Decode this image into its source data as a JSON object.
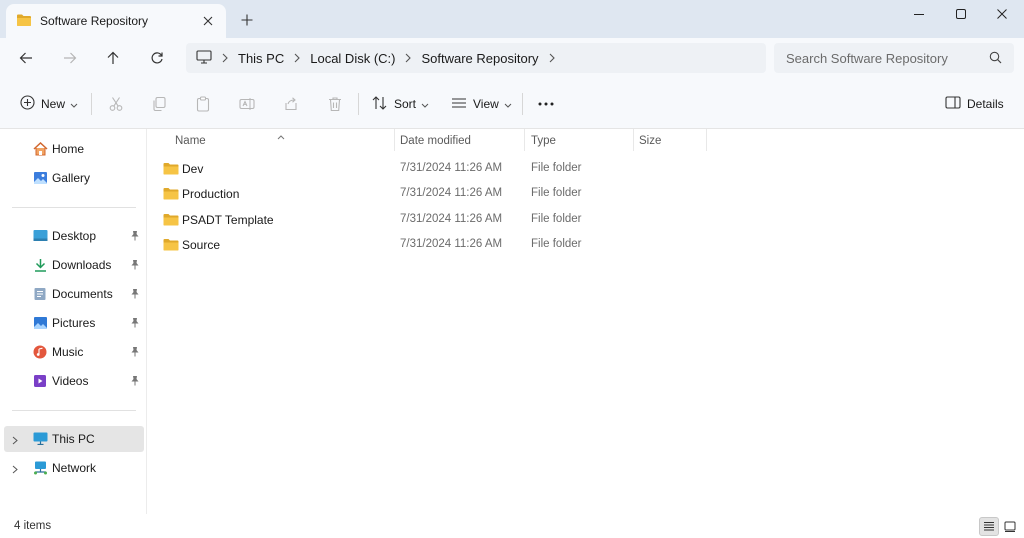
{
  "colors": {
    "folder": "#f6c445",
    "folder_dark": "#e0a92b",
    "accent": "#0067c0",
    "selected": "#e5e5e5"
  },
  "tab": {
    "title": "Software Repository",
    "icon": "folder-icon"
  },
  "window_controls": [
    "minimize-icon",
    "maximize-icon",
    "close-icon"
  ],
  "breadcrumb": {
    "items": [
      "This PC",
      "Local Disk (C:)",
      "Software Repository"
    ]
  },
  "search": {
    "placeholder": "Search Software Repository"
  },
  "command_bar": {
    "new_label": "New",
    "sort_label": "Sort",
    "view_label": "View",
    "details_label": "Details",
    "disabled_icons": [
      "cut-icon",
      "copy-icon",
      "paste-icon",
      "rename-icon",
      "share-icon",
      "delete-icon"
    ]
  },
  "sidebar": {
    "top": [
      {
        "label": "Home",
        "icon": "home-icon"
      },
      {
        "label": "Gallery",
        "icon": "gallery-icon"
      }
    ],
    "quick_access": [
      {
        "label": "Desktop",
        "icon": "desktop-icon",
        "pinned": true
      },
      {
        "label": "Downloads",
        "icon": "downloads-icon",
        "pinned": true
      },
      {
        "label": "Documents",
        "icon": "documents-icon",
        "pinned": true
      },
      {
        "label": "Pictures",
        "icon": "pictures-icon",
        "pinned": true
      },
      {
        "label": "Music",
        "icon": "music-icon",
        "pinned": true
      },
      {
        "label": "Videos",
        "icon": "videos-icon",
        "pinned": true
      }
    ],
    "locations": [
      {
        "label": "This PC",
        "icon": "this-pc-icon",
        "selected": true
      },
      {
        "label": "Network",
        "icon": "network-icon",
        "selected": false
      }
    ]
  },
  "table": {
    "columns": [
      "Name",
      "Date modified",
      "Type",
      "Size"
    ],
    "rows": [
      {
        "name": "Dev",
        "date": "7/31/2024 11:26 AM",
        "type": "File folder",
        "size": ""
      },
      {
        "name": "Production",
        "date": "7/31/2024 11:26 AM",
        "type": "File folder",
        "size": ""
      },
      {
        "name": "PSADT Template",
        "date": "7/31/2024 11:26 AM",
        "type": "File folder",
        "size": ""
      },
      {
        "name": "Source",
        "date": "7/31/2024 11:26 AM",
        "type": "File folder",
        "size": ""
      }
    ]
  },
  "status": {
    "item_count": "4 items"
  }
}
